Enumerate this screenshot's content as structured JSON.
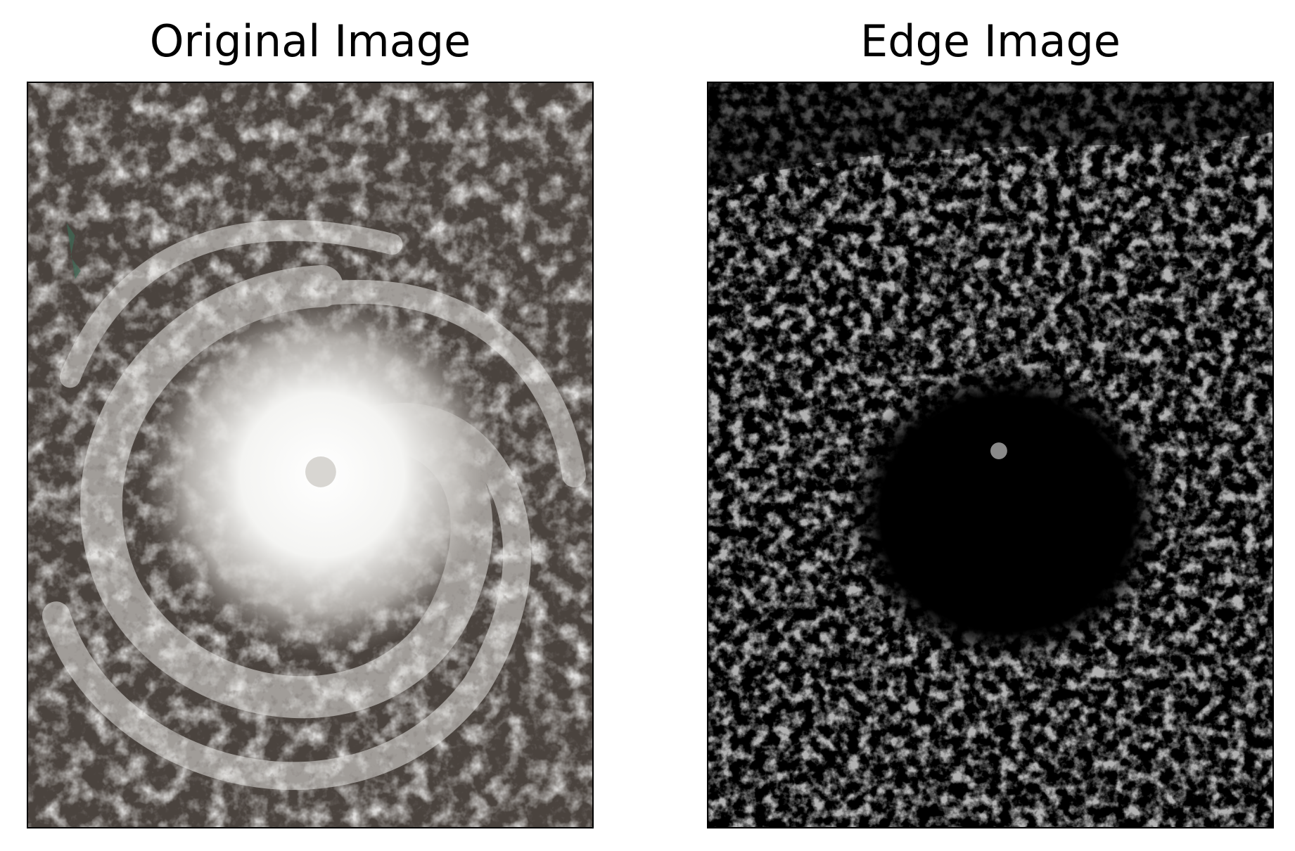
{
  "figure": {
    "panels": [
      {
        "title": "Original Image",
        "content": "satellite-cyclone-photo"
      },
      {
        "title": "Edge Image",
        "content": "edge-detection-result"
      }
    ]
  },
  "colors": {
    "background": "#ffffff",
    "frame": "#000000",
    "cloud": "#f3f3f1",
    "ocean": "#3a3430",
    "edge_fill": "#6e6e6e",
    "edge_background": "#000000"
  }
}
